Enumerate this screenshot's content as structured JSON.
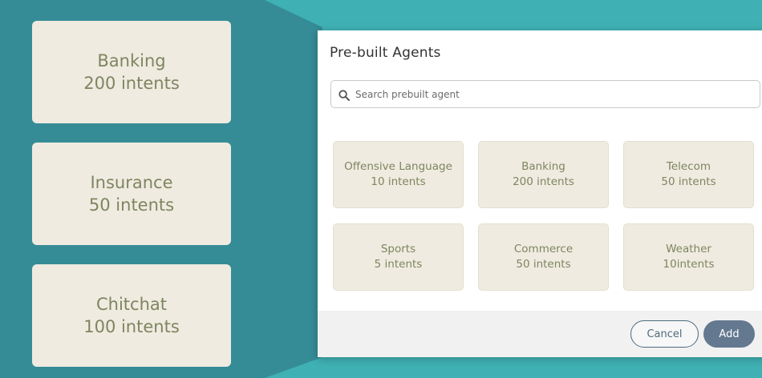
{
  "side_cards": [
    {
      "name": "Banking",
      "intents": "200 intents"
    },
    {
      "name": "Insurance",
      "intents": "50 intents"
    },
    {
      "name": "Chitchat",
      "intents": "100 intents"
    }
  ],
  "dialog": {
    "title": "Pre-built Agents",
    "search": {
      "placeholder": "Search prebuilt agent",
      "value": "",
      "icon": "search-icon"
    },
    "agents": [
      {
        "name": "Offensive Language",
        "intents": "10 intents"
      },
      {
        "name": "Banking",
        "intents": "200 intents"
      },
      {
        "name": "Telecom",
        "intents": "50 intents"
      },
      {
        "name": "Sports",
        "intents": "5 intents"
      },
      {
        "name": "Commerce",
        "intents": "50 intents"
      },
      {
        "name": "Weather",
        "intents": "10intents"
      }
    ],
    "cancel_label": "Cancel",
    "add_label": "Add"
  },
  "colors": {
    "background": "#3fb1b4",
    "panel": "#358c97",
    "card": "#efebe0",
    "card_text": "#7e8560",
    "add_button": "#647890",
    "cancel_border": "#4e6a7e"
  }
}
